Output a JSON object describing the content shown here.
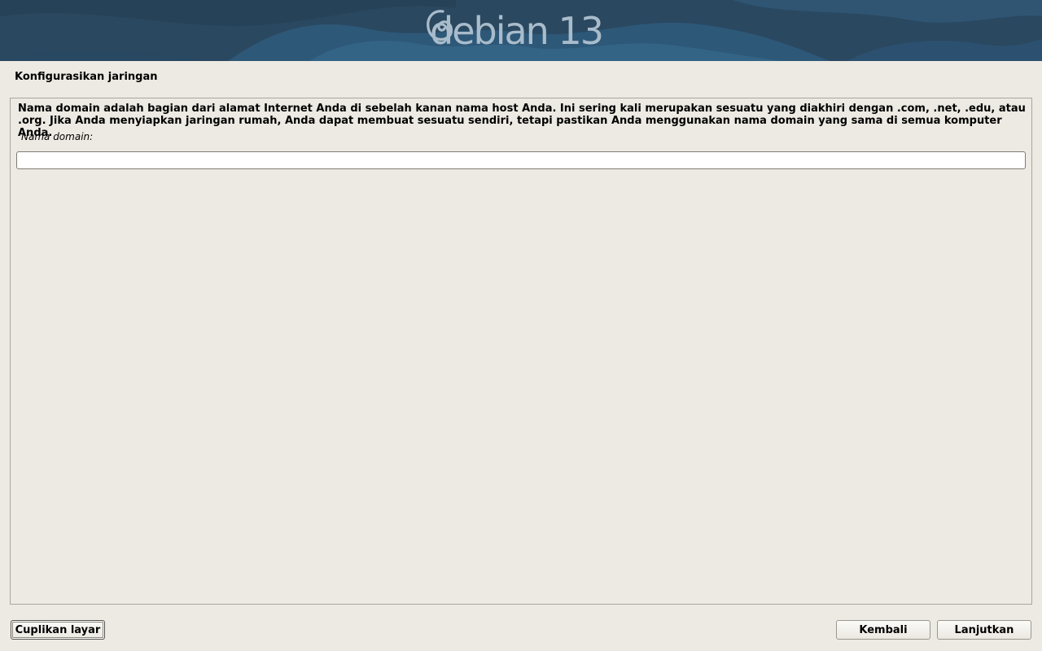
{
  "banner": {
    "logo_text": "debian 13",
    "background_color": "#2b4a63",
    "logo_color": "#a9bccb"
  },
  "page": {
    "title": "Konfigurasikan jaringan"
  },
  "content": {
    "description": "Nama domain adalah bagian dari alamat Internet Anda di sebelah kanan nama host Anda.  Ini sering kali merupakan sesuatu yang diakhiri dengan .com, .net, .edu, atau .org.  Jika Anda menyiapkan jaringan rumah, Anda dapat membuat sesuatu sendiri, tetapi pastikan Anda menggunakan nama domain yang sama di semua komputer Anda.",
    "field_label": "Nama domain:",
    "field_value": ""
  },
  "buttons": {
    "screenshot": "Cuplikan layar",
    "back": "Kembali",
    "continue": "Lanjutkan"
  },
  "icons": {
    "logo": "debian-swirl-icon"
  }
}
